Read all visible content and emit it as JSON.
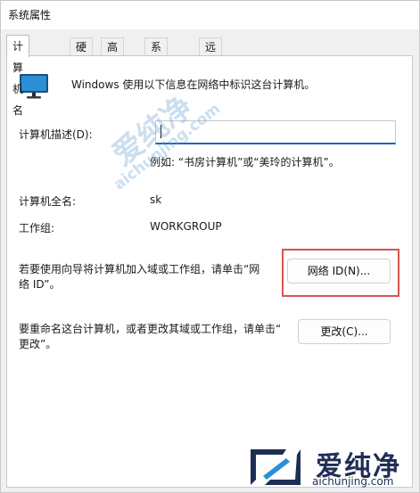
{
  "window": {
    "title": "系统属性"
  },
  "tabs": [
    {
      "label": "计算机名",
      "active": true
    },
    {
      "label": "硬件"
    },
    {
      "label": "高级"
    },
    {
      "label": "系统保护"
    },
    {
      "label": "远程"
    }
  ],
  "intro_text": "Windows 使用以下信息在网络中标识这台计算机。",
  "description": {
    "label": "计算机描述(D):",
    "value": "",
    "hint": "例如: “书房计算机”或“美玲的计算机”。"
  },
  "full_name": {
    "label": "计算机全名:",
    "value": "sk"
  },
  "workgroup": {
    "label": "工作组:",
    "value": "WORKGROUP"
  },
  "network_id": {
    "text_line1": "若要使用向导将计算机加入域或工作组，请单击“网",
    "text_line2": "络 ID”。",
    "button_label": "网络 ID(N)..."
  },
  "rename": {
    "text_line1": "要重命名这台计算机，或者更改其域或工作组，请单击“",
    "text_line2": "更改”。",
    "button_label": "更改(C)..."
  },
  "watermark": {
    "text": "爱纯净",
    "url": "aichunjing.com"
  },
  "colors": {
    "highlight": "#d9534f",
    "focus_underline": "#1a63c4",
    "logo": "#1f2e55"
  }
}
